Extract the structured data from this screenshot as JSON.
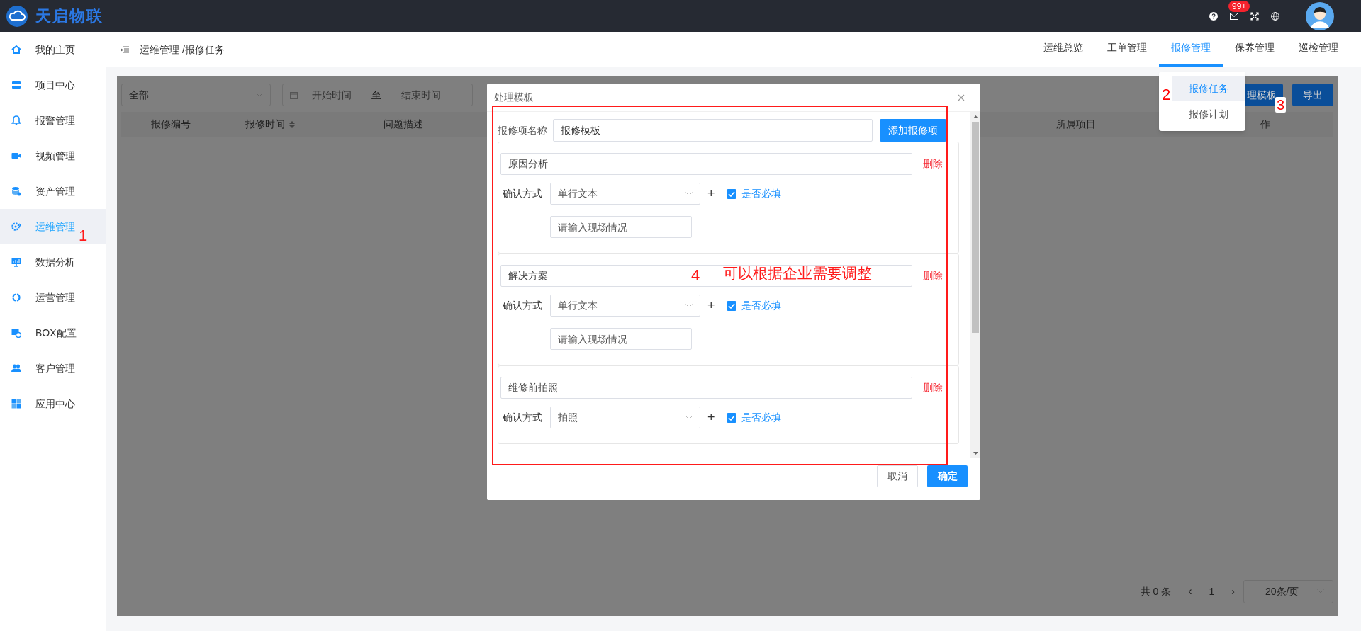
{
  "app": {
    "logo_text": "天启物联",
    "notification_badge": "99+"
  },
  "sidebar": {
    "items": [
      {
        "label": "我的主页",
        "selected": false
      },
      {
        "label": "项目中心",
        "selected": false
      },
      {
        "label": "报警管理",
        "selected": false
      },
      {
        "label": "视频管理",
        "selected": false
      },
      {
        "label": "资产管理",
        "selected": false
      },
      {
        "label": "运维管理",
        "selected": true
      },
      {
        "label": "数据分析",
        "selected": false
      },
      {
        "label": "运营管理",
        "selected": false
      },
      {
        "label": "BOX配置",
        "selected": false
      },
      {
        "label": "客户管理",
        "selected": false
      },
      {
        "label": "应用中心",
        "selected": false
      }
    ]
  },
  "breadcrumb": "运维管理 /报修任务",
  "tabs": [
    {
      "label": "运维总览",
      "selected": false
    },
    {
      "label": "工单管理",
      "selected": false
    },
    {
      "label": "报修管理",
      "selected": true
    },
    {
      "label": "保养管理",
      "selected": false
    },
    {
      "label": "巡检管理",
      "selected": false
    }
  ],
  "tab_dropdown": {
    "items": [
      {
        "label": "报修任务",
        "selected": true
      },
      {
        "label": "报修计划",
        "selected": false
      }
    ]
  },
  "filters": {
    "status_select": "全部",
    "start_placeholder": "开始时间",
    "separator": "至",
    "end_placeholder": "结束时间"
  },
  "toolbar_buttons": [
    "理模板",
    "导出"
  ],
  "table": {
    "columns": [
      {
        "label": "报修编号"
      },
      {
        "label": "报修时间"
      },
      {
        "label": "问题描述"
      },
      {
        "label": "所属项目"
      },
      {
        "label": "作"
      }
    ]
  },
  "pagination": {
    "total": "共 0 条",
    "prev": "‹",
    "page": "1",
    "next": "›",
    "page_size": "20条/页"
  },
  "dialog": {
    "title": "处理模板",
    "name_label": "报修项名称",
    "name_value": "报修模板",
    "add_button": "添加报修项",
    "items": [
      {
        "name": "原因分析",
        "delete": "删除",
        "confirm_label": "确认方式",
        "method": "单行文本",
        "plus": "+",
        "required": true,
        "required_label": "是否必填",
        "placeholder": "请输入现场情况"
      },
      {
        "name": "解决方案",
        "delete": "删除",
        "confirm_label": "确认方式",
        "method": "单行文本",
        "plus": "+",
        "required": true,
        "required_label": "是否必填",
        "placeholder": "请输入现场情况"
      },
      {
        "name": "维修前拍照",
        "delete": "删除",
        "confirm_label": "确认方式",
        "method": "拍照",
        "plus": "+",
        "required": true,
        "required_label": "是否必填"
      }
    ],
    "cancel": "取消",
    "ok": "确定"
  },
  "annotations": [
    {
      "text": "1"
    },
    {
      "text": "2"
    },
    {
      "text": "3"
    },
    {
      "text": "4"
    },
    {
      "text": "可以根据企业需要调整"
    }
  ]
}
